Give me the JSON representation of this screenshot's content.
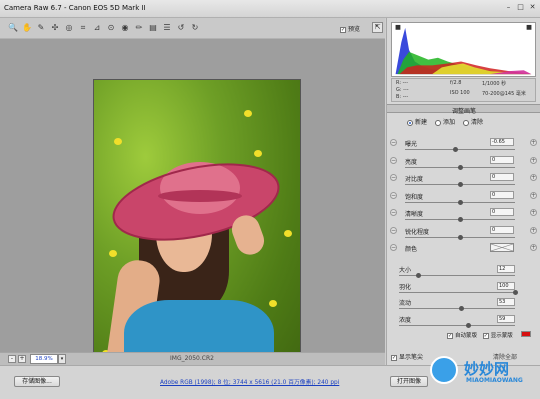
{
  "window": {
    "title": "Camera Raw 6.7 - Canon EOS 5D Mark II",
    "min": "–",
    "max": "□",
    "close": "✕"
  },
  "toolbar": {
    "tools": [
      "zoom-icon",
      "hand-icon",
      "white-balance-icon",
      "color-sampler-icon",
      "target-adjust-icon",
      "crop-icon",
      "straighten-icon",
      "spot-removal-icon",
      "red-eye-icon",
      "adjustment-brush-icon",
      "graduated-filter-icon",
      "preferences-icon",
      "rotate-ccw-icon",
      "rotate-cw-icon"
    ],
    "tool_glyphs": [
      "🔍",
      "✋",
      "✎",
      "✣",
      "◎",
      "⌗",
      "⊿",
      "⊙",
      "◉",
      "✏",
      "▤",
      "☰",
      "↺",
      "↻"
    ],
    "preview_label": "预览",
    "preview_checked": true,
    "fullscreen_glyph": "⇱"
  },
  "status": {
    "zoom": "18.9%",
    "zoom_minus": "-",
    "zoom_plus": "+",
    "filename": "IMG_2050.CR2"
  },
  "camera": {
    "r": "R:  ---",
    "g": "G:  ---",
    "b": "B:  ---",
    "aperture": "f/2.8",
    "shutter": "1/1000 秒",
    "iso": "ISO 100",
    "lens": "70-200@145 毫米"
  },
  "panel": {
    "title": "调整画笔",
    "modes": [
      "新建",
      "添加",
      "清除"
    ],
    "selected_mode": 0,
    "adjustments": [
      {
        "label": "曝光",
        "value": "-0.65",
        "pos": 0.45
      },
      {
        "label": "亮度",
        "value": "0",
        "pos": 0.5
      },
      {
        "label": "对比度",
        "value": "0",
        "pos": 0.5
      },
      {
        "label": "饱和度",
        "value": "0",
        "pos": 0.5
      },
      {
        "label": "清晰度",
        "value": "0",
        "pos": 0.5
      },
      {
        "label": "锐化程度",
        "value": "0",
        "pos": 0.5
      },
      {
        "label": "颜色",
        "value": "",
        "pos": null
      }
    ],
    "brush": [
      {
        "label": "大小",
        "value": "12",
        "pos": 0.15
      },
      {
        "label": "羽化",
        "value": "100",
        "pos": 1.0
      },
      {
        "label": "流动",
        "value": "53",
        "pos": 0.53
      },
      {
        "label": "浓度",
        "value": "59",
        "pos": 0.59
      }
    ],
    "auto_mask": "自动蒙版",
    "show_mask_overlay": "显示蒙版",
    "show_pins": "显示笔尖",
    "clear_all": "清除全部",
    "mask_color": "#d61010"
  },
  "bottom": {
    "save": "存储图像...",
    "workflow": "Adobe RGB (1998); 8 位; 3744 x 5616 (21.0 百万像素); 240 ppi",
    "open": "打开图像",
    "cancel": "取消",
    "done": "完成"
  },
  "watermark": {
    "cn": "妙妙网",
    "en": "MIAOMIAOWANG"
  }
}
